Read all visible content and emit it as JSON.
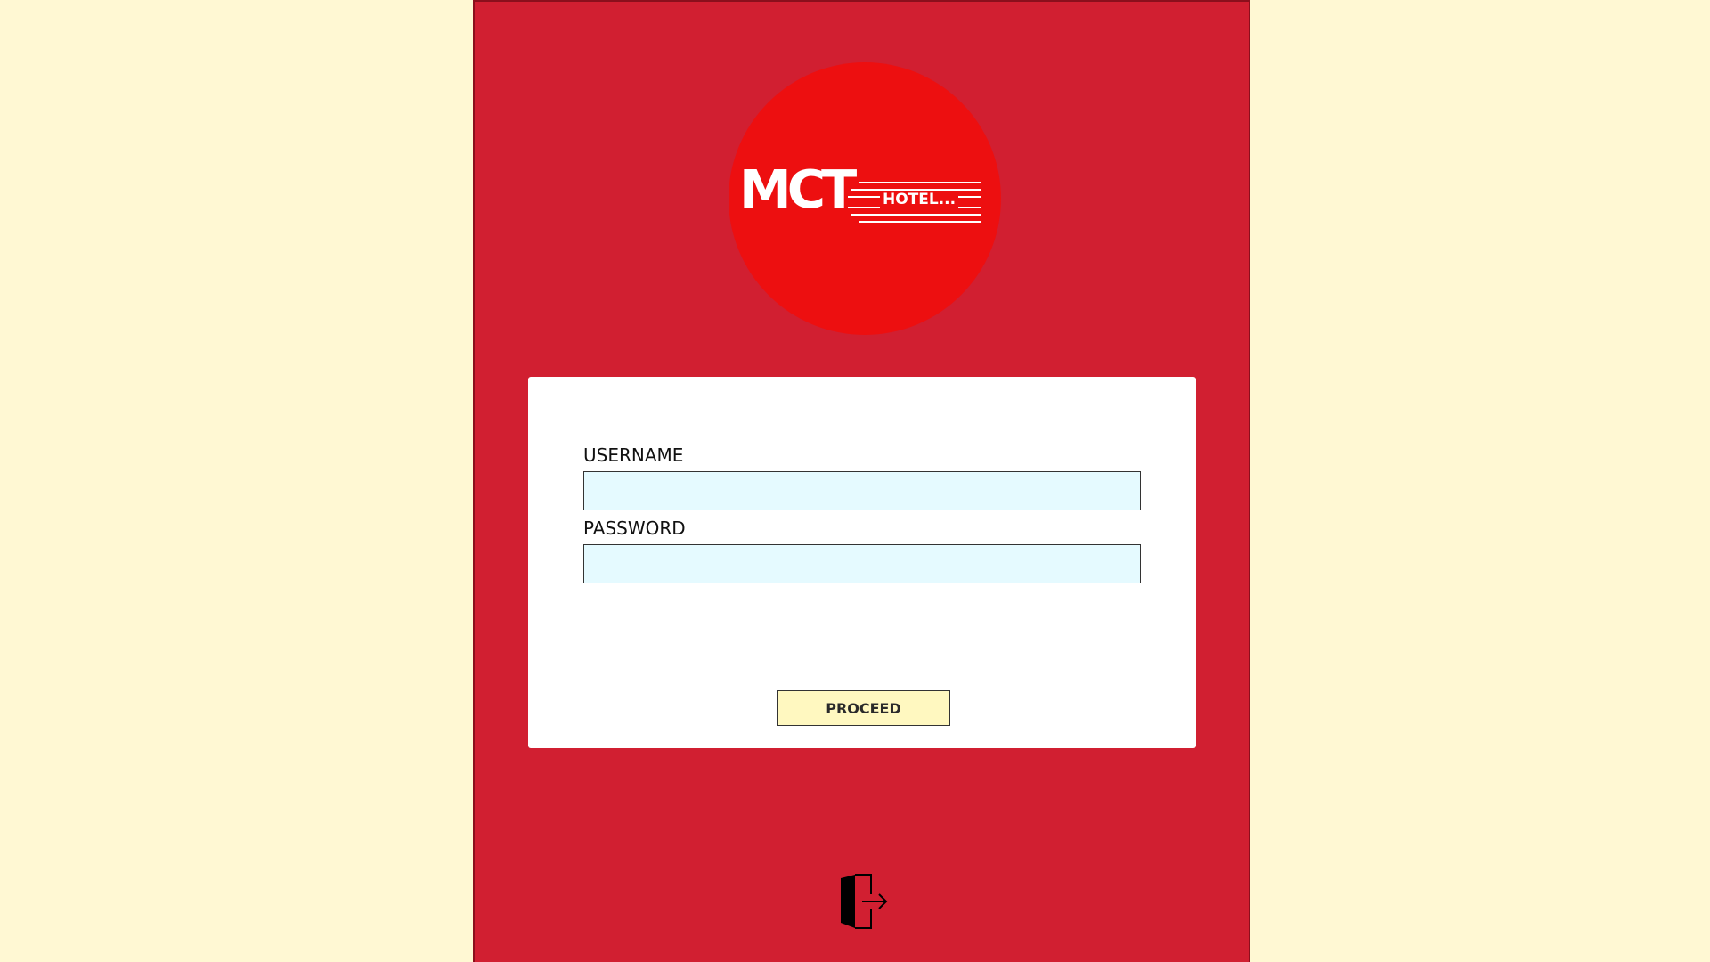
{
  "logo": {
    "brand": "MCT",
    "subtitle": "HOTEL..."
  },
  "login": {
    "username_label": "USERNAME",
    "username_value": "",
    "password_label": "PASSWORD",
    "password_value": "",
    "proceed_label": "PROCEED"
  },
  "icons": {
    "exit": "door-exit-icon"
  },
  "colors": {
    "page_background": "#FFF8D3",
    "panel_background": "#D11F31",
    "logo_circle": "#ED0F10",
    "input_background": "#E5FAFF",
    "button_background": "#FFF8C0"
  }
}
